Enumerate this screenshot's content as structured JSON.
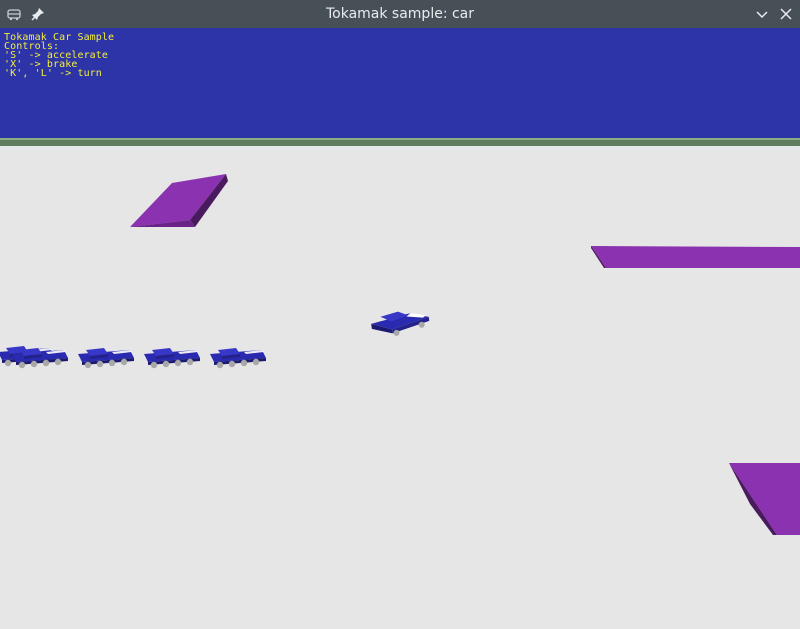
{
  "window": {
    "title": "Tokamak sample: car",
    "icons": [
      "car-app-icon",
      "pin-icon",
      "chevron-down-icon",
      "close-icon"
    ]
  },
  "hud": {
    "lines": [
      "Tokamak Car Sample",
      "Controls:",
      "'S' -> accelerate",
      "'X' -> brake",
      "'K', 'L' -> turn"
    ],
    "text_color": "#f4ef3a",
    "background": "#2c34a8"
  },
  "scene": {
    "ground_color": "#e6e6e6",
    "horizon_color": "#5f7d5c",
    "ramp_color": "#8a32b0",
    "car_color": "#2a2ab0"
  }
}
